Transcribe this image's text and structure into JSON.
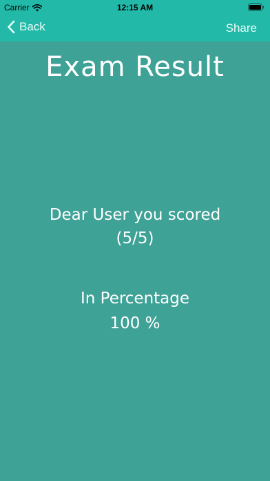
{
  "status_bar": {
    "carrier": "Carrier",
    "time": "12:15 AM",
    "icons": [
      "wifi-icon",
      "battery-icon"
    ]
  },
  "nav": {
    "back_label": "Back",
    "share_label": "Share",
    "back_icon": "chevron-left-icon"
  },
  "result": {
    "title": "Exam Result",
    "score_line": "Dear User you scored",
    "score_value": "(5/5)",
    "percent_label": "In Percentage",
    "percent_value": "100 %"
  },
  "colors": {
    "background": "#3fa297",
    "bar": "#22b9a8",
    "text": "#ffffff"
  }
}
